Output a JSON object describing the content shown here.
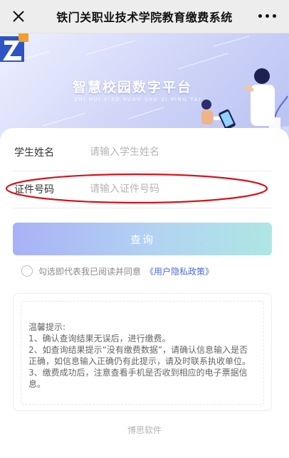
{
  "navbar": {
    "title": "铁门关职业技术学院教育缴费系统",
    "close_icon": "close-icon",
    "more_icon": "more-icon"
  },
  "banner": {
    "title": "智慧校园数字平台",
    "subtitle": "ZHI HUI XIAO YUAN SHU ZI PING TAI"
  },
  "form": {
    "student_name_label": "学生姓名",
    "student_name_placeholder": "请输入学生姓名",
    "student_name_value": "",
    "id_number_label": "证件号码",
    "id_number_placeholder": "请输入证件号码",
    "id_number_value": ""
  },
  "query_button": "查询",
  "agreement": {
    "text": "勾选即代表我已阅读并同意",
    "link": "《用户隐私政策》",
    "checked": false
  },
  "tips": {
    "heading": "温馨提示:",
    "lines": [
      "1、确认查询结果无误后，进行缴费。",
      "2、如查询结果提示“没有缴费数据”，请确认信息输入是否正确，如信息输入正确仍有此提示，请及时联系执收单位。",
      "3、缴费成功后，注意查看手机是否收到相应的电子票据信息。"
    ]
  },
  "footer": "博思软件",
  "colors": {
    "accent_link": "#4a6be0",
    "annotation": "#d8121b",
    "button_start": "#a9b1f6",
    "button_end": "#aee6e4"
  }
}
